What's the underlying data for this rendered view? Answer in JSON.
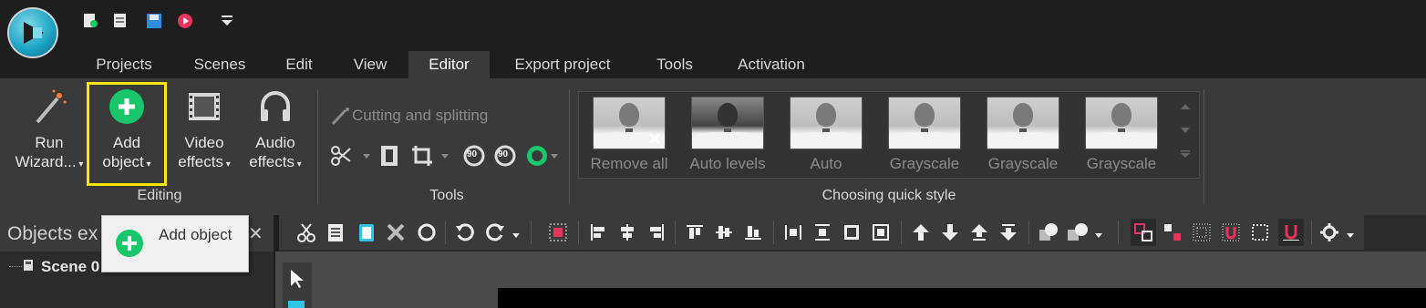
{
  "tabs": [
    "Projects",
    "Scenes",
    "Edit",
    "View",
    "Editor",
    "Export project",
    "Tools",
    "Activation"
  ],
  "active_tab": "Editor",
  "editing_group": {
    "label": "Editing",
    "run_wizard": [
      "Run",
      "Wizard..."
    ],
    "add_object": [
      "Add",
      "object"
    ],
    "video_effects": [
      "Video",
      "effects"
    ],
    "audio_effects": [
      "Audio",
      "effects"
    ]
  },
  "tools_group": {
    "label": "Tools",
    "cutting": "Cutting and splitting",
    "rotate_left": "90",
    "rotate_right": "90"
  },
  "quick_style_group": {
    "label": "Choosing quick style",
    "styles": [
      "Remove all",
      "Auto levels",
      "Auto",
      "Grayscale",
      "Grayscale",
      "Grayscale"
    ]
  },
  "objects_panel": {
    "title": "Objects ex",
    "scene": "Scene 0"
  },
  "tooltip": {
    "text": "Add object"
  },
  "colors": {
    "accent_green": "#17c76a",
    "highlight_yellow": "#ffe600",
    "ribbon_bg": "#3a3a3a",
    "title_bg": "#1e1e1e"
  }
}
